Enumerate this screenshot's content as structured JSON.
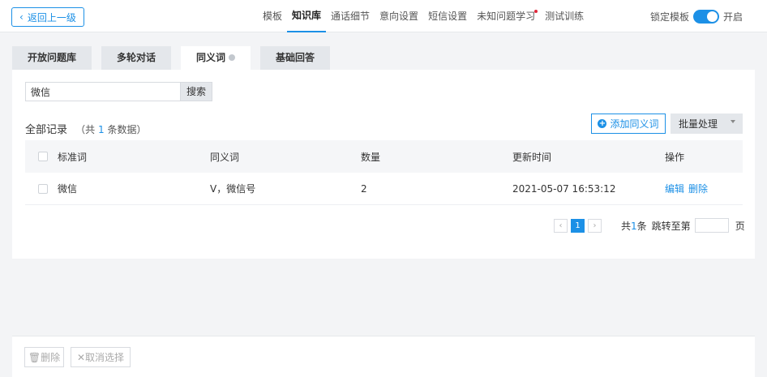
{
  "topbar": {
    "back_label": "返回上一级",
    "nav": [
      {
        "label": "模板"
      },
      {
        "label": "知识库"
      },
      {
        "label": "通话细节"
      },
      {
        "label": "意向设置"
      },
      {
        "label": "短信设置"
      },
      {
        "label": "未知问题学习"
      },
      {
        "label": "测试训练"
      }
    ],
    "active_nav": "知识库",
    "lock_label": "锁定模板",
    "lock_state": "开启"
  },
  "tabs": [
    {
      "label": "开放问题库"
    },
    {
      "label": "多轮对话"
    },
    {
      "label": "同义词"
    },
    {
      "label": "基础回答"
    }
  ],
  "search": {
    "value": "微信",
    "button": "搜索"
  },
  "records": {
    "title": "全部记录",
    "prefix": "（共",
    "count": "1",
    "suffix": "条数据）"
  },
  "actions": {
    "add": "添加同义词",
    "batch": "批量处理"
  },
  "table": {
    "headers": [
      "标准词",
      "同义词",
      "数量",
      "更新时间",
      "操作"
    ],
    "rows": [
      {
        "word": "微信",
        "synonyms": "V，微信号",
        "count": "2",
        "updated": "2021-05-07 16:53:12",
        "edit": "编辑",
        "delete": "删除"
      }
    ]
  },
  "pagination": {
    "current": "1",
    "total_prefix": "共",
    "total": "1",
    "total_suffix": "条",
    "jump": "跳转至第",
    "unit": "页"
  },
  "bottom": {
    "delete": "删除",
    "cancel": "取消选择"
  },
  "colors": {
    "accent": "#1c90e6",
    "badge": "#e0263a"
  }
}
